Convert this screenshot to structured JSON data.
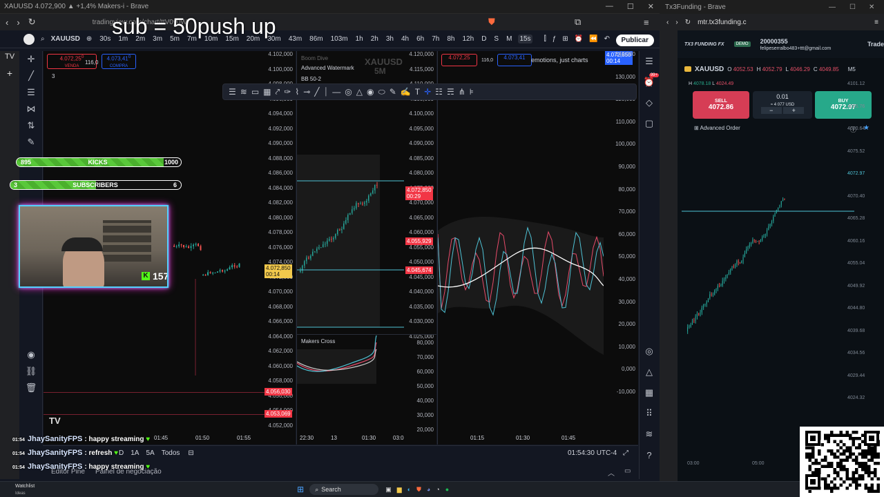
{
  "overlay_title": "sub = 50push up",
  "left_window": {
    "title": "XAUUSD 4.072,900 ▲ +1,4% Makers-i - Brave",
    "url": "tradingview.com/chart/ttV0y0W/",
    "symbol": "XAUUSD",
    "timeframes": [
      "30s",
      "1m",
      "2m",
      "3m",
      "5m",
      "7m",
      "10m",
      "15m",
      "20m",
      "30m",
      "43m",
      "86m",
      "103m",
      "1h",
      "2h",
      "3h",
      "4h",
      "6h",
      "7h",
      "8h",
      "12h",
      "D",
      "S",
      "M",
      "15s"
    ],
    "active_timeframe": "15s",
    "publish_label": "Publicar",
    "sell_price": "4.072,25",
    "sell_sup": "0",
    "sell_label": "VENDA",
    "buy_price": "4.073,41",
    "buy_sup": "0",
    "buy_label": "COMPRA",
    "spread": "116,0",
    "indicator_count": "3",
    "pane1": {
      "price_axis": [
        "4.102,000",
        "4.100,000",
        "4.098,000",
        "4.096,000",
        "4.094,000",
        "4.092,000",
        "4.090,000",
        "4.088,000",
        "4.086,000",
        "4.084,000",
        "4.082,000",
        "4.080,000",
        "4.078,000",
        "4.076,000",
        "4.074,000",
        "4.072,000",
        "4.070,000",
        "4.068,000",
        "4.066,000",
        "4.064,000",
        "4.062,000",
        "4.060,000",
        "4.058,000",
        "4.056,000",
        "4.054,000",
        "4.052,000"
      ],
      "current_price": "4.072,850",
      "current_timer": "00:14",
      "tag1": "4.056,030",
      "tag2": "4.053,069",
      "time_axis": [
        "01:45",
        "01:50",
        "01:55"
      ]
    },
    "pane2": {
      "watermark_symbol": "XAUUSD",
      "watermark_tf": "5M",
      "boom_label": "Boom Dive",
      "advanced_watermark": "Advanced Watermark",
      "bb_label": "BB 50-2",
      "price_axis": [
        "4.120,000",
        "4.115,000",
        "4.110,000",
        "4.105,000",
        "4.100,000",
        "4.095,000",
        "4.090,000",
        "4.085,000",
        "4.080,000",
        "4.075,000",
        "4.070,000",
        "4.065,000",
        "4.060,000",
        "4.055,000",
        "4.050,000",
        "4.045,000",
        "4.040,000",
        "4.035,000",
        "4.030,000",
        "4.025,000"
      ],
      "current_price": "4.072,850",
      "current_timer": "00:29",
      "tag1": "4.055,929",
      "tag2": "4.045,674",
      "sub_label": "Makers Cross",
      "sub_axis": [
        "80,000",
        "70,000",
        "60,000",
        "50,000",
        "40,000",
        "30,000",
        "20,000"
      ],
      "time_axis": [
        "22:30",
        "13",
        "01:30",
        "03:0"
      ]
    },
    "pane3": {
      "header_text": "emotions, just charts",
      "sell_price": "4.072,25",
      "buy_price": "4.073,41",
      "spread": "116,0",
      "current_price": "4.072,850",
      "current_timer": "00:14",
      "axis": [
        "140,000",
        "130,000",
        "120,000",
        "110,000",
        "100,000",
        "90,000",
        "80,000",
        "70,000",
        "60,000",
        "50,000",
        "40,000",
        "30,000",
        "20,000",
        "10,000",
        "0,000",
        "-10,000"
      ],
      "time_axis": [
        "01:15",
        "01:30",
        "01:45"
      ]
    },
    "bottom": {
      "ranges": [
        "D",
        "1A",
        "5A",
        "Todos"
      ],
      "clock": "01:54:30 UTC-4",
      "tabs": [
        "Editor Pine",
        "Painel de negociação"
      ]
    },
    "notification_badge": "99+"
  },
  "overlays": {
    "kicks_left": "895",
    "kicks_label": "KICKS",
    "kicks_goal": "1000",
    "kicks_progress": 0.895,
    "subs_left": "3",
    "subs_label": "SUBSCRIBERS",
    "subs_goal": "6",
    "subs_progress": 0.5,
    "viewer_count": "157",
    "chat": [
      {
        "time": "01:54",
        "user": "JhaySanityFPS",
        "msg": ": happy streaming"
      },
      {
        "time": "01:54",
        "user": "JhaySanityFPS",
        "msg": ": refresh"
      },
      {
        "time": "01:54",
        "user": "JhaySanityFPS",
        "msg": ": happy streaming"
      }
    ]
  },
  "right_window": {
    "title": "Tx3Funding - Brave",
    "url": "mtr.tx3funding.c",
    "brand": "TX3 FUNDING FX",
    "demo_label": "DEMO",
    "account_id": "20000355",
    "account_email": "felipeserralbo483+ttt@gmail.com",
    "trade_label": "Trade",
    "symbol": "XAUUSD",
    "ohlc": {
      "o": "4052.53",
      "h": "4052.79",
      "l": "4046.29",
      "c": "4049.85"
    },
    "timeframe": "M5",
    "hl_line": {
      "h": "4078.18",
      "l": "4024.49"
    },
    "sell_label": "SELL",
    "sell_price": "4072.86",
    "buy_label": "BUY",
    "buy_price": "4072.97",
    "volume": "0.01",
    "volume_usd": "≈ 4 077 USD",
    "advanced_order": "Advanced Order",
    "price_axis": [
      "4101.12",
      "4085.76",
      "4080.64",
      "4075.52",
      "4072.97",
      "4070.40",
      "4065.28",
      "4060.16",
      "4055.04",
      "4049.92",
      "4044.80",
      "4039.68",
      "4034.56",
      "4029.44",
      "4024.32"
    ],
    "time_axis": [
      "03:00",
      "05:00"
    ]
  },
  "taskbar": {
    "widget_title": "Watchlist",
    "widget_sub": "Ideas",
    "search_placeholder": "Search"
  }
}
